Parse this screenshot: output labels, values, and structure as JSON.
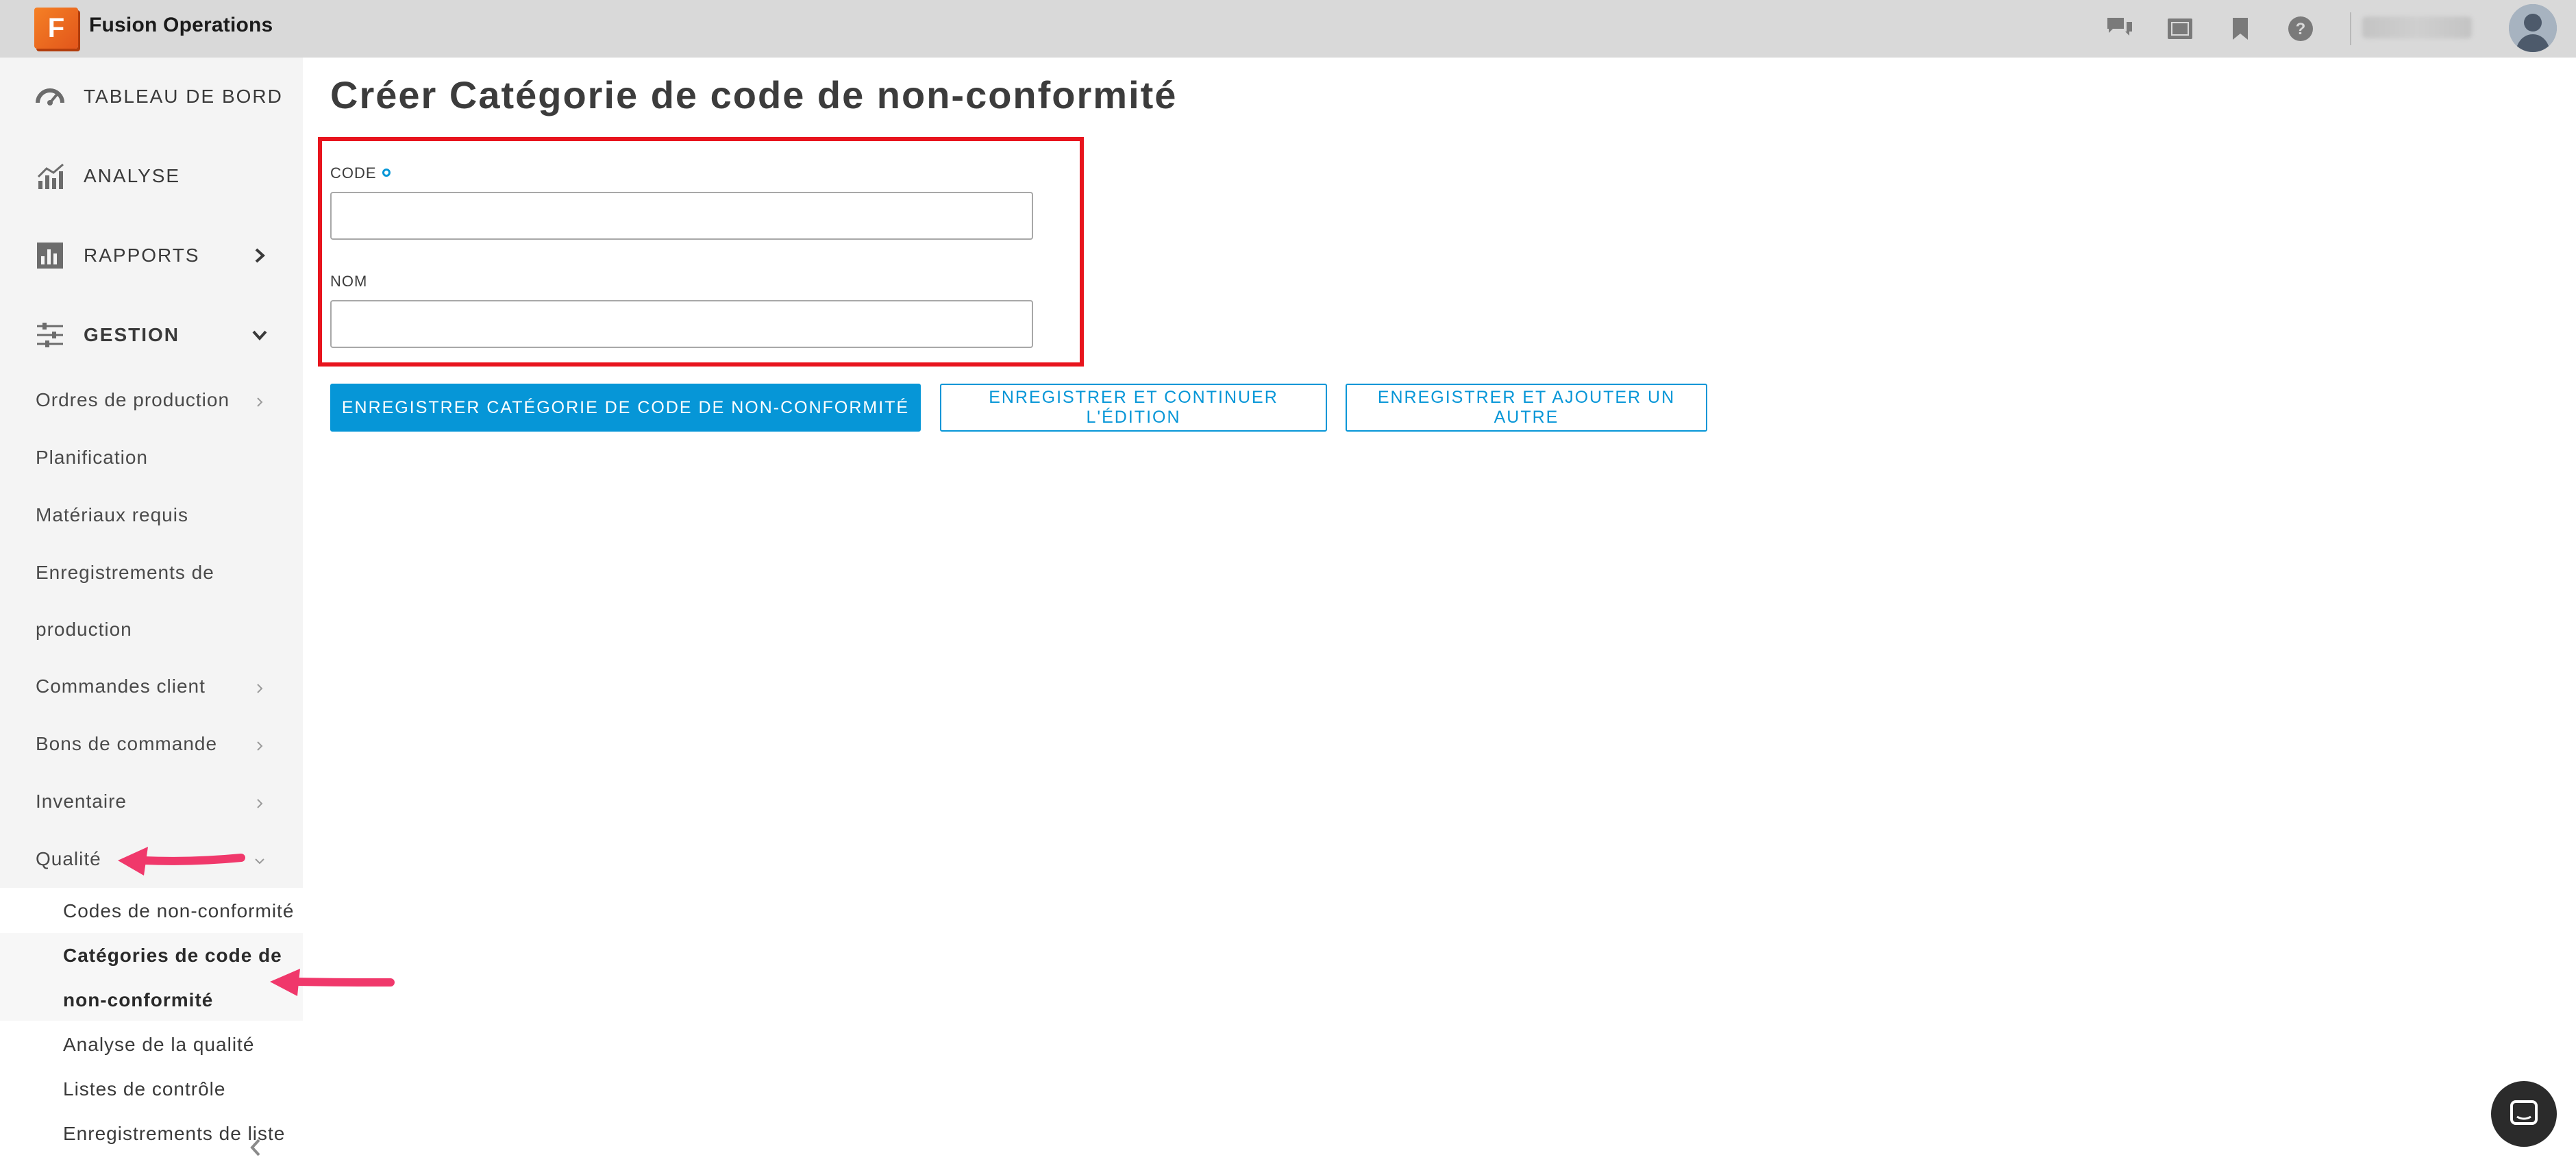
{
  "app": {
    "logo_letter": "F",
    "title": "Fusion Operations",
    "user_name": "Utilisateur"
  },
  "topbar_icons": [
    "chat-icon",
    "screen-icon",
    "bookmark-icon",
    "help-icon"
  ],
  "sidebar": {
    "main_items": [
      {
        "label": "TABLEAU DE BORD",
        "icon": "dashboard-icon"
      },
      {
        "label": "ANALYSE",
        "icon": "analytics-icon"
      },
      {
        "label": "RAPPORTS",
        "icon": "reports-icon",
        "chevron": "right"
      },
      {
        "label": "GESTION",
        "icon": "sliders-icon",
        "chevron": "down"
      }
    ],
    "gestion_items": [
      {
        "label": "Ordres de production",
        "has_chevron": true
      },
      {
        "label": "Planification",
        "has_chevron": false
      },
      {
        "label": "Matériaux requis",
        "has_chevron": false
      },
      {
        "label": "Enregistrements de",
        "has_chevron": false
      },
      {
        "label": "production",
        "has_chevron": false
      },
      {
        "label": "Commandes client",
        "has_chevron": true
      },
      {
        "label": "Bons de commande",
        "has_chevron": true
      },
      {
        "label": "Inventaire",
        "has_chevron": true
      },
      {
        "label": "Qualité",
        "has_chevron": true
      }
    ],
    "qualite_items": [
      {
        "label": "Codes de non-conformité"
      },
      {
        "label": "Catégories de code de",
        "active": true
      },
      {
        "label": "non-conformité",
        "active": true
      },
      {
        "label": "Analyse de la qualité"
      },
      {
        "label": "Listes de contrôle"
      },
      {
        "label": "Enregistrements de liste"
      }
    ]
  },
  "main": {
    "title": "Créer Catégorie de code de non-conformité",
    "fields": {
      "code_label": "CODE",
      "code_value": "",
      "nom_label": "NOM",
      "nom_value": ""
    },
    "buttons": {
      "save": "ENREGISTRER CATÉGORIE DE CODE DE NON-CONFORMITÉ",
      "save_continue": "ENREGISTRER ET CONTINUER L'ÉDITION",
      "save_add": "ENREGISTRER ET AJOUTER UN AUTRE"
    }
  },
  "colors": {
    "accent": "#0696d7",
    "highlight": "#e8141d",
    "annotation_arrow": "#f0386b",
    "topbar": "#d9d9d9",
    "sidebar": "#f4f4f4"
  }
}
